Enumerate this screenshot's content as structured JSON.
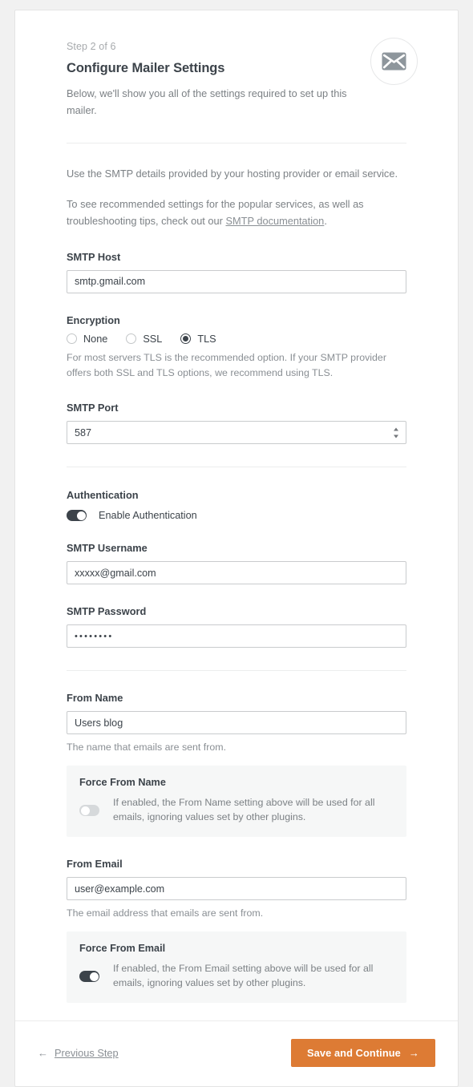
{
  "header": {
    "step_label": "Step 2 of 6",
    "title": "Configure Mailer Settings",
    "description": "Below, we'll show you all of the settings required to set up this mailer.",
    "icon": "envelope-icon"
  },
  "intro": {
    "paragraph_1": "Use the SMTP details provided by your hosting provider or email service.",
    "paragraph_2_before": "To see recommended settings for the popular services, as well as troubleshooting tips, check out our ",
    "link_text": "SMTP documentation",
    "paragraph_2_after": "."
  },
  "smtp_host": {
    "label": "SMTP Host",
    "value": "smtp.gmail.com",
    "placeholder": "smtp.gmail.com"
  },
  "encryption": {
    "label": "Encryption",
    "options": [
      {
        "label": "None",
        "checked": false
      },
      {
        "label": "SSL",
        "checked": false
      },
      {
        "label": "TLS",
        "checked": true
      }
    ],
    "help": "For most servers TLS is the recommended option. If your SMTP provider offers both SSL and TLS options, we recommend using TLS."
  },
  "smtp_port": {
    "label": "SMTP Port",
    "value": "587"
  },
  "authentication": {
    "label": "Authentication",
    "toggle_label": "Enable Authentication",
    "enabled": true
  },
  "smtp_username": {
    "label": "SMTP Username",
    "value": "xxxxx@gmail.com",
    "placeholder": "xxxxx@gmail.com"
  },
  "smtp_password": {
    "label": "SMTP Password",
    "value": "••••••••"
  },
  "from_name": {
    "label": "From Name",
    "value": "Users blog",
    "placeholder": "Users blog",
    "help": "The name that emails are sent from.",
    "force": {
      "title": "Force From Name",
      "description": "If enabled, the From Name setting above will be used for all emails, ignoring values set by other plugins.",
      "enabled": false
    }
  },
  "from_email": {
    "label": "From Email",
    "value": "user@example.com",
    "placeholder": "user@example.com",
    "help": "The email address that emails are sent from.",
    "force": {
      "title": "Force From Email",
      "description": "If enabled, the From Email setting above will be used for all emails, ignoring values set by other plugins.",
      "enabled": true
    }
  },
  "footer": {
    "previous_label": "Previous Step",
    "previous_arrow": "←",
    "save_label": "Save and Continue",
    "save_arrow": "→",
    "accent_color": "#dd7b34"
  }
}
